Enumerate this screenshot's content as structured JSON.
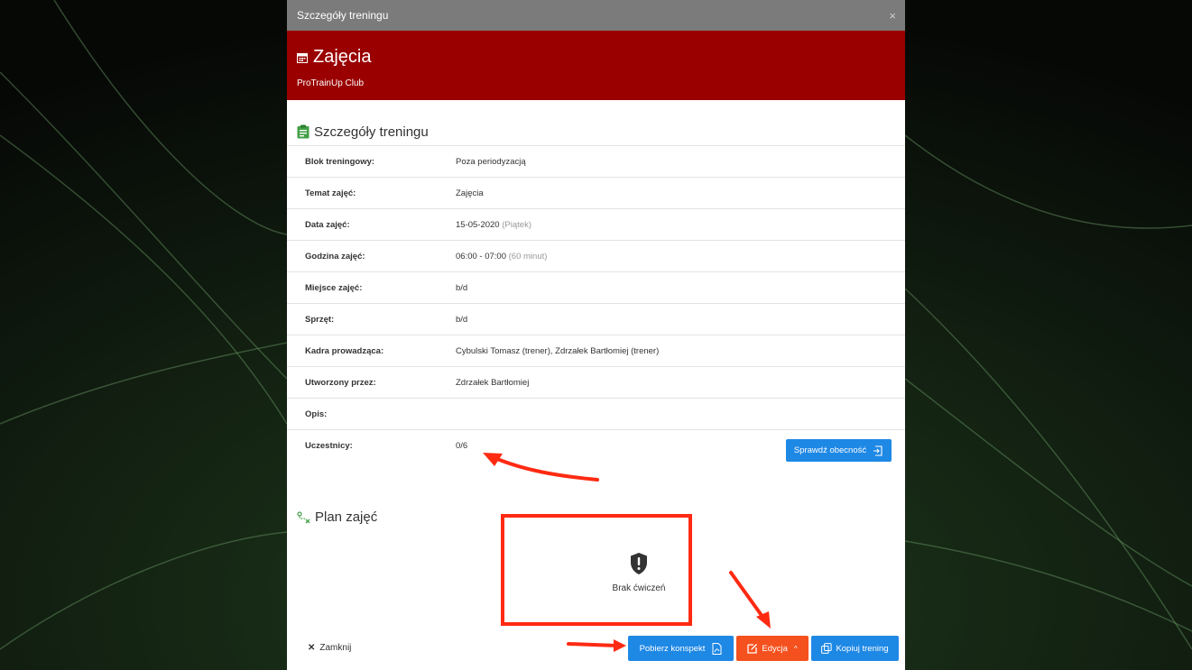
{
  "window": {
    "title": "Szczegóły treningu",
    "close_glyph": "×"
  },
  "header": {
    "title": "Zajęcia",
    "club": "ProTrainUp Club",
    "icon": "calendar-icon",
    "background": "#9a0000"
  },
  "details": {
    "title": "Szczegóły treningu",
    "icon": "clipboard-icon",
    "rows": [
      {
        "label": "Blok treningowy:",
        "value": "Poza periodyzacją",
        "note": ""
      },
      {
        "label": "Temat zajęć:",
        "value": "Zajęcia",
        "note": ""
      },
      {
        "label": "Data zajęć:",
        "value": "15-05-2020",
        "note": "(Piątek)"
      },
      {
        "label": "Godzina zajęć:",
        "value": "06:00 - 07:00",
        "note": "(60 minut)"
      },
      {
        "label": "Miejsce zajęć:",
        "value": "b/d",
        "note": ""
      },
      {
        "label": "Sprzęt:",
        "value": "b/d",
        "note": ""
      },
      {
        "label": "Kadra prowadząca:",
        "value": "Cybulski Tomasz (trener), Zdrzałek Bartłomiej (trener)",
        "note": ""
      },
      {
        "label": "Utworzony przez:",
        "value": "Zdrzałek Bartłomiej",
        "note": ""
      },
      {
        "label": "Opis:",
        "value": "",
        "note": ""
      }
    ],
    "participants": {
      "label": "Uczestnicy:",
      "value": "0/6",
      "button": "Sprawdź obecność"
    }
  },
  "plan": {
    "title": "Plan zajęć",
    "icon": "exercise-path-icon",
    "empty_text": "Brak ćwiczeń",
    "empty_icon": "shield-alert-icon"
  },
  "footer": {
    "close_label": "Zamknij",
    "pdf_button": "Pobierz konspekt",
    "edit_button": "Edycja",
    "copy_button": "Kopiuj trening"
  },
  "colors": {
    "primary": "#1e88e5",
    "edit": "#f4511e",
    "annotation": "#ff2a12",
    "green_icon": "#43a047"
  }
}
